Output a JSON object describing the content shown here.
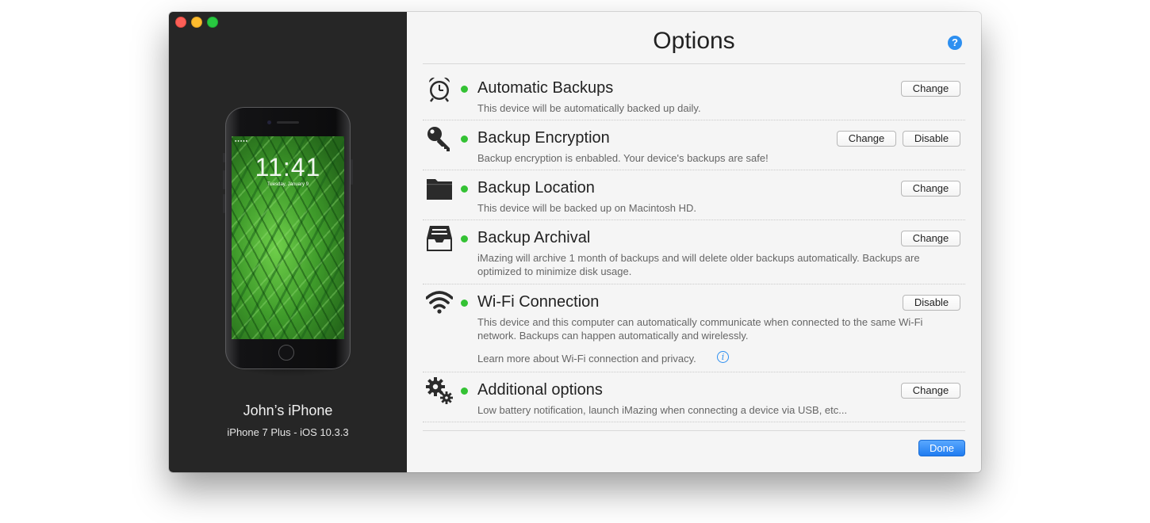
{
  "window": {
    "title": "Options"
  },
  "device": {
    "name": "John’s iPhone",
    "model": "iPhone 7 Plus - iOS 10.3.3",
    "lock_time": "11:41",
    "lock_date": "Tuesday, January 9"
  },
  "help": {
    "label": "?"
  },
  "options": [
    {
      "title": "Automatic Backups",
      "icon": "alarm-clock-icon",
      "status": "enabled",
      "description": "This device will be automatically backed up daily.",
      "buttons": [
        "Change"
      ]
    },
    {
      "title": "Backup Encryption",
      "icon": "key-icon",
      "status": "enabled",
      "description": "Backup encryption is enbabled. Your device's backups are safe!",
      "buttons": [
        "Change",
        "Disable"
      ]
    },
    {
      "title": "Backup Location",
      "icon": "folder-icon",
      "status": "enabled",
      "description": "This device will be backed up on Macintosh HD.",
      "buttons": [
        "Change"
      ]
    },
    {
      "title": "Backup Archival",
      "icon": "archive-tray-icon",
      "status": "enabled",
      "description": "iMazing will archive 1 month of backups and will delete older backups automatically. Backups are optimized to minimize disk usage.",
      "buttons": [
        "Change"
      ]
    },
    {
      "title": "Wi-Fi Connection",
      "icon": "wifi-icon",
      "status": "enabled",
      "description": "This device and this computer can automatically communicate when connected to the same Wi-Fi network. Backups can happen automatically and wirelessly.",
      "link": "Learn more about Wi-Fi connection and privacy.",
      "buttons": [
        "Disable"
      ]
    },
    {
      "title": "Additional options",
      "icon": "gears-icon",
      "status": "enabled",
      "description": "Low battery notification, launch iMazing when connecting a device via USB, etc...",
      "buttons": [
        "Change"
      ]
    }
  ],
  "footer": {
    "done_label": "Done"
  },
  "colors": {
    "status_green": "#34c234",
    "accent_blue": "#2d8ff0",
    "sidebar_bg": "#262626"
  }
}
